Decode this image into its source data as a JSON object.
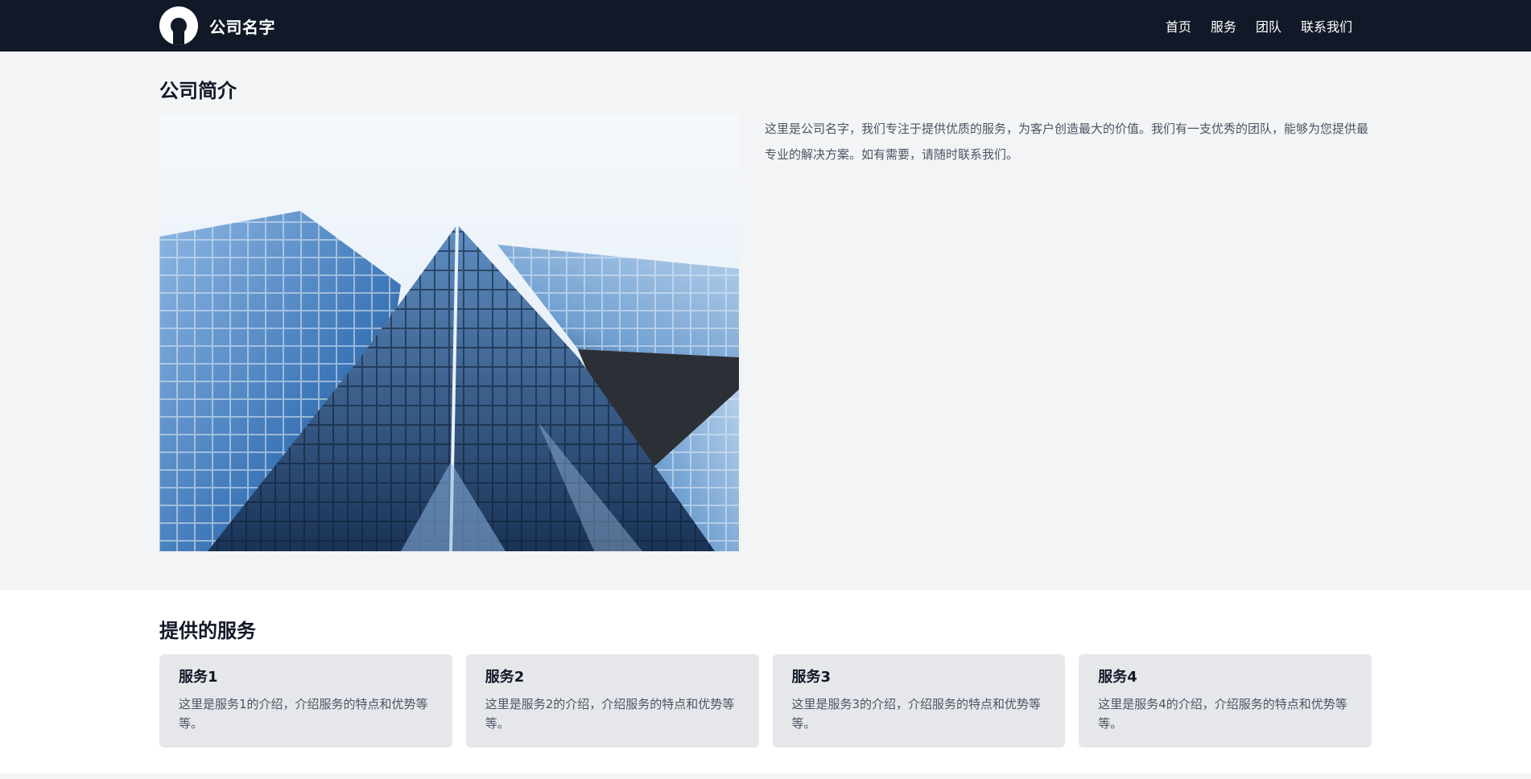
{
  "header": {
    "brand_name": "公司名字",
    "nav": [
      {
        "label": "首页"
      },
      {
        "label": "服务"
      },
      {
        "label": "团队"
      },
      {
        "label": "联系我们"
      }
    ]
  },
  "intro": {
    "title": "公司简介",
    "text": "这里是公司名字，我们专注于提供优质的服务，为客户创造最大的价值。我们有一支优秀的团队，能够为您提供最专业的解决方案。如有需要，请随时联系我们。"
  },
  "services": {
    "title": "提供的服务",
    "items": [
      {
        "title": "服务1",
        "desc": "这里是服务1的介绍，介绍服务的特点和优势等等。"
      },
      {
        "title": "服务2",
        "desc": "这里是服务2的介绍，介绍服务的特点和优势等等。"
      },
      {
        "title": "服务3",
        "desc": "这里是服务3的介绍，介绍服务的特点和优势等等。"
      },
      {
        "title": "服务4",
        "desc": "这里是服务4的介绍，介绍服务的特点和优势等等。"
      }
    ]
  },
  "colors": {
    "header_bg": "#111827",
    "page_bg": "#f3f4f6",
    "card_bg": "#e5e7eb",
    "text_muted": "#4b5563"
  },
  "icons": {
    "logo": "user-avatar-icon"
  }
}
